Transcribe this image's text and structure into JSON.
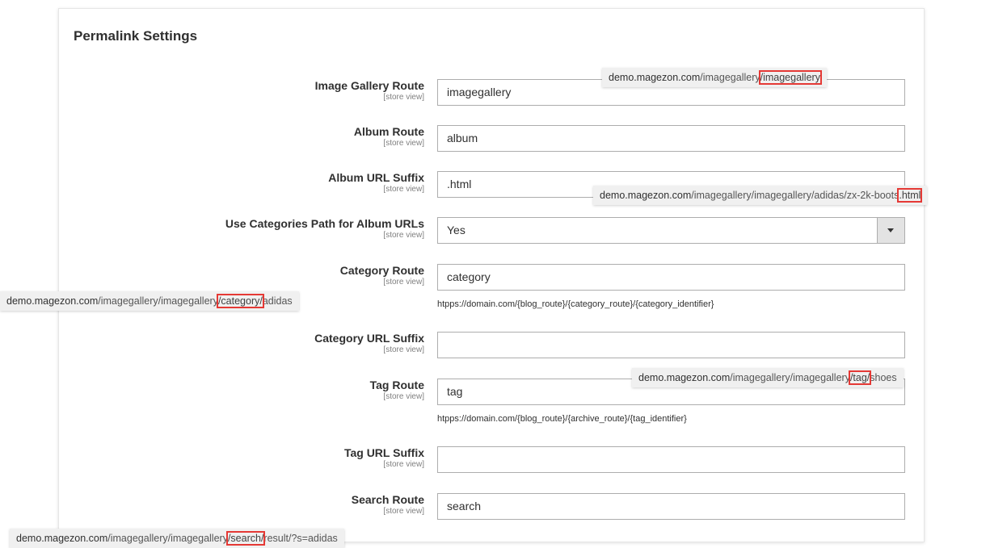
{
  "panel": {
    "title": "Permalink Settings"
  },
  "scope_label": "[store view]",
  "fields": [
    {
      "label": "Image Gallery Route",
      "value": "imagegallery"
    },
    {
      "label": "Album Route",
      "value": "album"
    },
    {
      "label": "Album URL Suffix",
      "value": ".html"
    },
    {
      "label": "Use Categories Path for Album URLs",
      "value": "Yes",
      "type": "select"
    },
    {
      "label": "Category Route",
      "value": "category",
      "note": "htpps://domain.com/{blog_route}/{category_route}/{category_identifier}"
    },
    {
      "label": "Category URL Suffix",
      "value": ""
    },
    {
      "label": "Tag Route",
      "value": "tag",
      "note": "htpps://domain.com/{blog_route}/{archive_route}/{tag_identifier}"
    },
    {
      "label": "Tag URL Suffix",
      "value": ""
    },
    {
      "label": "Search Route",
      "value": "search"
    }
  ],
  "tooltips": [
    {
      "domain": "demo.magezon.com",
      "prefix": "/imagegallery",
      "highlight": "/imagegallery",
      "suffix": ""
    },
    {
      "domain": "demo.magezon.com",
      "prefix": "/imagegallery/imagegallery/adidas/zx-2k-boots",
      "highlight": ".html",
      "suffix": ""
    },
    {
      "domain": "demo.magezon.com",
      "prefix": "/imagegallery/imagegallery",
      "highlight": "/category/",
      "suffix": "adidas"
    },
    {
      "domain": "demo.magezon.com",
      "prefix": "/imagegallery/imagegallery",
      "highlight": "/tag/",
      "suffix": "shoes"
    },
    {
      "domain": "demo.magezon.com",
      "prefix": "/imagegallery/imagegallery",
      "highlight": "/search/",
      "suffix": "result/?s=adidas"
    }
  ]
}
